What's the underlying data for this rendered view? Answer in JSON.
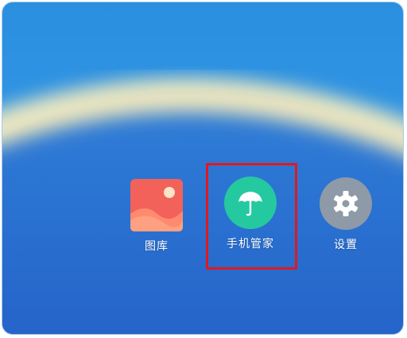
{
  "apps": [
    {
      "label": "图库",
      "icon": "gallery-icon"
    },
    {
      "label": "手机管家",
      "icon": "umbrella-icon"
    },
    {
      "label": "设置",
      "icon": "gear-icon"
    }
  ],
  "colors": {
    "gallery_bg": "#f2625a",
    "manager_bg": "#24c9a0",
    "settings_bg": "#8e9aa8",
    "highlight": "#e0191e"
  }
}
